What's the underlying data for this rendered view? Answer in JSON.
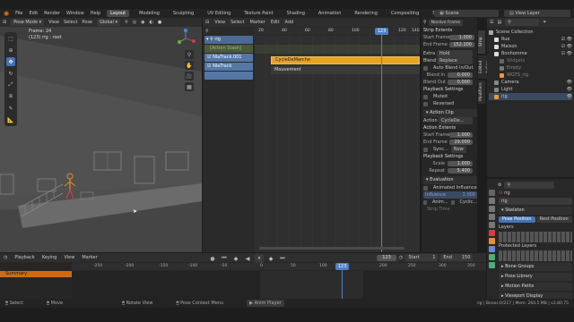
{
  "topbar": {
    "menus": [
      "File",
      "Edit",
      "Render",
      "Window",
      "Help"
    ],
    "workspaces": [
      "Layout",
      "Modeling",
      "Sculpting",
      "UV Editing",
      "Texture Paint",
      "Shading",
      "Animation",
      "Rendering",
      "Compositing",
      "Scripting"
    ],
    "active_workspace": "Layout",
    "scene_label": "Scene",
    "view_layer_label": "View Layer"
  },
  "viewport": {
    "mode": "Pose Mode",
    "menus": [
      "View",
      "Select",
      "Pose"
    ],
    "orientation": "Global",
    "overlay_line1": "Frame: 24",
    "overlay_line2": "(123) rig : root"
  },
  "nla": {
    "menus": [
      "View",
      "Select",
      "Marker",
      "Edit",
      "Add"
    ],
    "frame_current": "123",
    "ruler": [
      "20",
      "40",
      "60",
      "80",
      "100",
      "120",
      "140"
    ],
    "tracks": [
      "rig",
      "[Action Stash]",
      "NlaTrack.001",
      "NlaTrack",
      ""
    ],
    "strip_top": "CycleDeMarche",
    "strip_bottom": "Mouvement"
  },
  "strip_panel": {
    "tabs": [
      "Strip",
      "Edited Action",
      "Modifiers"
    ],
    "dropdown": "Nonlive Frame",
    "strip_extents_title": "Strip Extents",
    "frame_start_label": "Start Frame",
    "frame_start": "1.000",
    "frame_end_label": "End Frame",
    "frame_end": "152.200",
    "extrapolation_label": "Extra",
    "extrapolation": "Hold",
    "blending_label": "Blend",
    "blending": "Replace",
    "auto_blend_label": "Auto Blend In/Out",
    "blend_in_label": "Blend In",
    "blend_in": "0.000",
    "blend_out_label": "Blend Out",
    "blend_out": "0.000",
    "playback_title": "Playback Settings",
    "muted_label": "Muted",
    "reversed_label": "Reversed",
    "action_clip_title": "Action Clip",
    "action_label": "Action",
    "action_value": "CycleDe...",
    "action_extents_title": "Action Extents",
    "action_start_label": "Start Frame",
    "action_start": "1.000",
    "action_end_label": "End Frame",
    "action_end": "29.000",
    "sync_label": "Sync...",
    "now_label": "Now",
    "playback2_title": "Playback Settings",
    "scale_label": "Scale",
    "scale": "1.000",
    "repeat_label": "Repeat",
    "repeat": "5.400",
    "evaluation_title": "Evaluation",
    "animated_influence_label": "Animated Influence",
    "influence_label": "Influence",
    "influence": "1.000",
    "animated_time_label": "Anim...",
    "cyclic_label": "Cyclic...",
    "strip_time_label": "Strip Time"
  },
  "outliner": {
    "title": "Scene Collection",
    "items": [
      {
        "label": "Scene Collection",
        "indent": 0
      },
      {
        "label": "Rue",
        "indent": 1
      },
      {
        "label": "Maison",
        "indent": 1
      },
      {
        "label": "Bonhomme",
        "indent": 1
      },
      {
        "label": "Widgets",
        "indent": 2
      },
      {
        "label": "Empty",
        "indent": 2
      },
      {
        "label": "WGTS_rig",
        "indent": 2
      },
      {
        "label": "Camera",
        "indent": 1
      },
      {
        "label": "Light",
        "indent": 1
      },
      {
        "label": "rig",
        "indent": 1
      }
    ]
  },
  "properties": {
    "object_name": "rig",
    "data_name": "rig",
    "skeleton_title": "Skeleton",
    "pose_position": "Pose Position",
    "rest_position": "Rest Position",
    "layers_title": "Layers",
    "protected_layers_title": "Protected Layers",
    "sections": [
      "Bone Groups",
      "Pose Library",
      "Motion Paths",
      "Viewport Display"
    ]
  },
  "timeline": {
    "menus": [
      "Playback",
      "Keying",
      "View",
      "Marker"
    ],
    "frame_current": "123",
    "start_label": "Start",
    "start": "1",
    "end_label": "End",
    "end": "150",
    "ruler": [
      "-250",
      "-200",
      "-150",
      "-100",
      "-50",
      "0",
      "50",
      "100",
      "150",
      "200",
      "250",
      "300",
      "350",
      "400"
    ],
    "summary_label": "Summary"
  },
  "statusbar": {
    "items": [
      "Select",
      "Move",
      "Rotate View",
      "Pose Context Menu",
      "Anim Player"
    ],
    "stats": "rig | Bones:0/217 | Mem: 264.5 MB | v2.80.75"
  },
  "colors": {
    "accent": "#4772b3",
    "strip": "#e4a424",
    "playhead": "#4f80c8",
    "summary": "#cf6a12"
  }
}
